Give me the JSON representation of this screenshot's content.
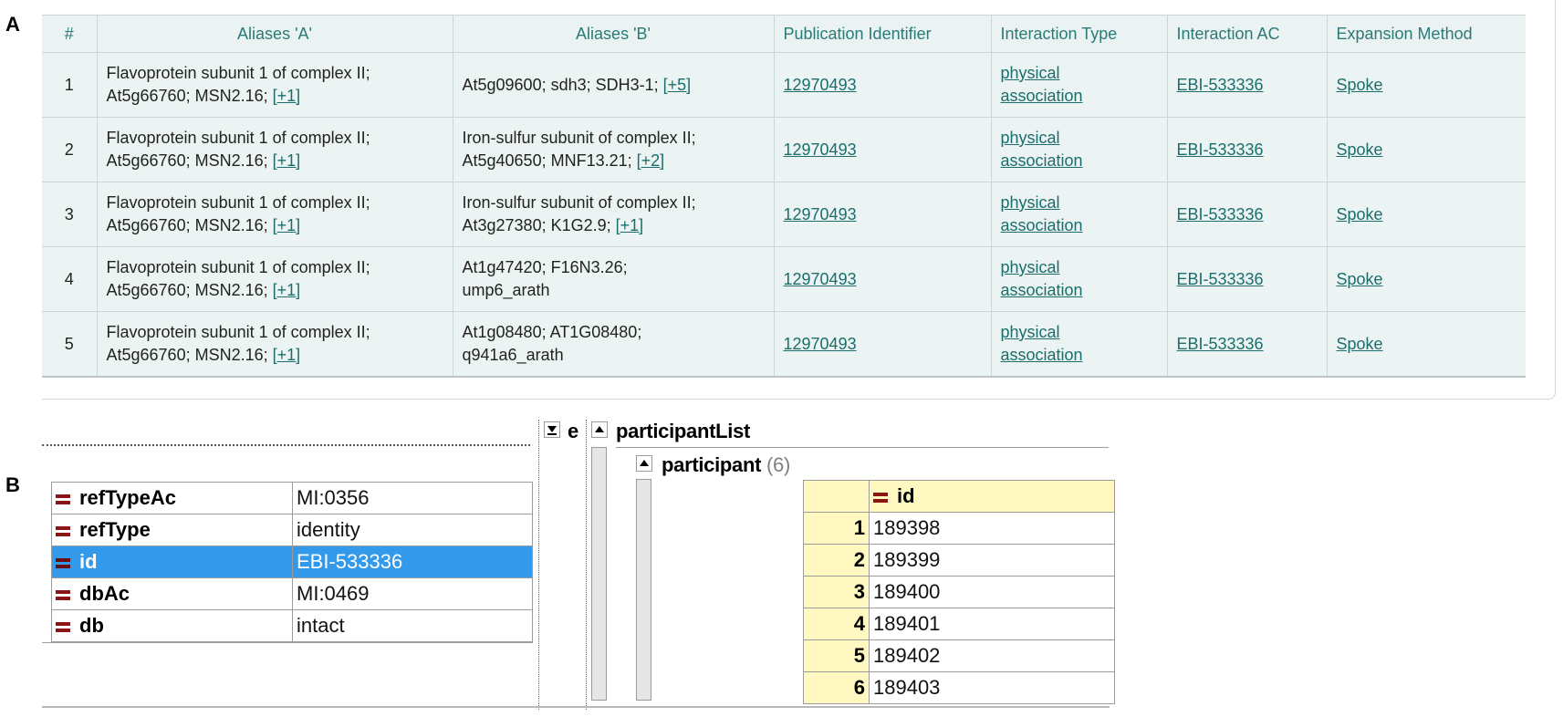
{
  "panel_labels": {
    "a": "A",
    "b": "B"
  },
  "panel_a": {
    "columns": [
      "#",
      "Aliases 'A'",
      "Aliases 'B'",
      "Publication Identifier",
      "Interaction Type",
      "Interaction AC",
      "Expansion Method"
    ],
    "rows": [
      {
        "num": "1",
        "alias_a_line1": "Flavoprotein subunit 1 of complex II;",
        "alias_a_line2": "At5g66760; MSN2.16;",
        "alias_a_more": "[+1]",
        "alias_b_line1": "At5g09600; sdh3; SDH3-1;",
        "alias_b_line2": "",
        "alias_b_more": "[+5]",
        "pub_id": "12970493",
        "type_line1": "physical",
        "type_line2": "association",
        "ac": "EBI-533336",
        "method": "Spoke"
      },
      {
        "num": "2",
        "alias_a_line1": "Flavoprotein subunit 1 of complex II;",
        "alias_a_line2": "At5g66760; MSN2.16;",
        "alias_a_more": "[+1]",
        "alias_b_line1": "Iron-sulfur subunit of complex II;",
        "alias_b_line2": "At5g40650; MNF13.21;",
        "alias_b_more": "[+2]",
        "pub_id": "12970493",
        "type_line1": "physical",
        "type_line2": "association",
        "ac": "EBI-533336",
        "method": "Spoke"
      },
      {
        "num": "3",
        "alias_a_line1": "Flavoprotein subunit 1 of complex II;",
        "alias_a_line2": "At5g66760; MSN2.16;",
        "alias_a_more": "[+1]",
        "alias_b_line1": "Iron-sulfur subunit of complex II;",
        "alias_b_line2": "At3g27380; K1G2.9;",
        "alias_b_more": "[+1]",
        "pub_id": "12970493",
        "type_line1": "physical",
        "type_line2": "association",
        "ac": "EBI-533336",
        "method": "Spoke"
      },
      {
        "num": "4",
        "alias_a_line1": "Flavoprotein subunit 1 of complex II;",
        "alias_a_line2": "At5g66760; MSN2.16;",
        "alias_a_more": "[+1]",
        "alias_b_line1": "At1g47420; F16N3.26;",
        "alias_b_line2": "ump6_arath",
        "alias_b_more": "",
        "pub_id": "12970493",
        "type_line1": "physical",
        "type_line2": "association",
        "ac": "EBI-533336",
        "method": "Spoke"
      },
      {
        "num": "5",
        "alias_a_line1": "Flavoprotein subunit 1 of complex II;",
        "alias_a_line2": "At5g66760; MSN2.16;",
        "alias_a_more": "[+1]",
        "alias_b_line1": "At1g08480; AT1G08480;",
        "alias_b_line2": "q941a6_arath",
        "alias_b_more": "",
        "pub_id": "12970493",
        "type_line1": "physical",
        "type_line2": "association",
        "ac": "EBI-533336",
        "method": "Spoke"
      }
    ]
  },
  "panel_b": {
    "attributes": [
      {
        "key": "refTypeAc",
        "value": "MI:0356",
        "selected": false
      },
      {
        "key": "refType",
        "value": "identity",
        "selected": false
      },
      {
        "key": "id",
        "value": "EBI-533336",
        "selected": true
      },
      {
        "key": "dbAc",
        "value": "MI:0469",
        "selected": false
      },
      {
        "key": "db",
        "value": "intact",
        "selected": false
      }
    ],
    "collapsed_label": "e",
    "participant_list_label": "participantList",
    "participant_label": "participant",
    "participant_count": "(6)",
    "id_column": "id",
    "participants": [
      {
        "index": "1",
        "id": "189398"
      },
      {
        "index": "2",
        "id": "189399"
      },
      {
        "index": "3",
        "id": "189400"
      },
      {
        "index": "4",
        "id": "189401"
      },
      {
        "index": "5",
        "id": "189402"
      },
      {
        "index": "6",
        "id": "189403"
      }
    ]
  }
}
